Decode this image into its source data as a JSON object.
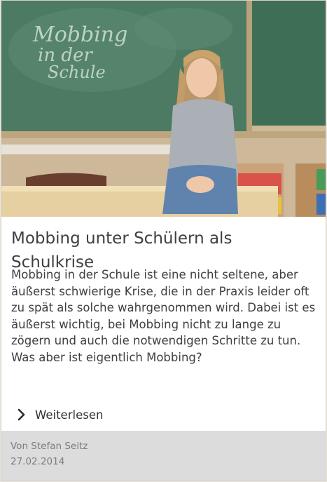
{
  "article": {
    "image_alt": "",
    "chalkboard_text": "Mobbing in der Schule",
    "title": "Mobbing unter Schülern als Schulkrise",
    "excerpt": "Mobbing in der Schule ist eine nicht seltene, aber äußerst schwierige Krise, die in der Praxis leider oft zu spät als solche wahrgenommen wird. Dabei ist es äußerst wichtig, bei Mobbing nicht zu lange zu zögern und auch die notwendigen Schritte zu tun. Was aber ist eigentlich Mobbing?",
    "read_more": "Weiterlesen",
    "read_more_icon": "chevron-right-icon",
    "author": "Von Stefan Seitz",
    "date": "27.02.2014"
  },
  "colors": {
    "text": "#3f3f3f",
    "footer_bg": "#dcdcdc",
    "footer_text": "#7c7c7c",
    "chalkboard": "#4f7a63"
  }
}
